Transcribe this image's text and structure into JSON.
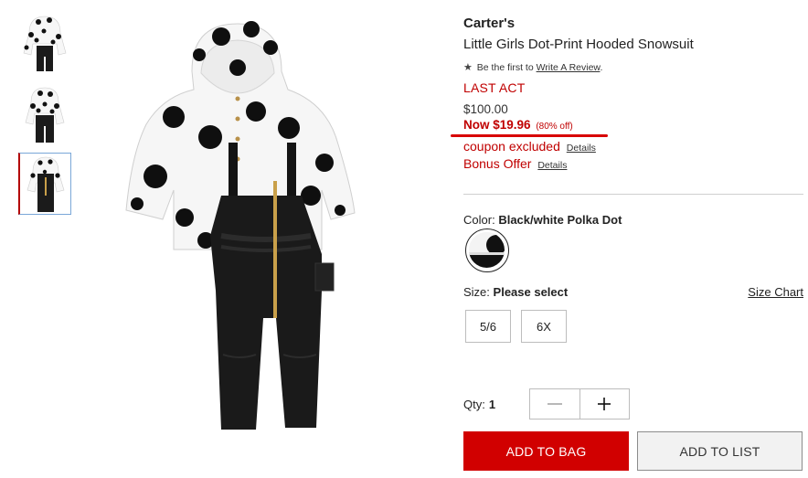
{
  "thumbnails": [
    {
      "name": "thumbnail-1",
      "selected": false
    },
    {
      "name": "thumbnail-2",
      "selected": false
    },
    {
      "name": "thumbnail-3",
      "selected": true
    }
  ],
  "product": {
    "brand": "Carter's",
    "title": "Little Girls Dot-Print Hooded Snowsuit"
  },
  "review": {
    "star_icon": "star-icon",
    "prefix": "Be the first to",
    "link": "Write A Review",
    "suffix": "."
  },
  "pricing": {
    "badge": "LAST ACT",
    "original": "$100.00",
    "now": "Now $19.96",
    "discount": "(80% off)",
    "coupon_text": "coupon excluded",
    "coupon_details": "Details",
    "bonus_text": "Bonus Offer",
    "bonus_details": "Details"
  },
  "color": {
    "label": "Color:",
    "value": "Black/white Polka Dot"
  },
  "size": {
    "label": "Size:",
    "value": "Please select",
    "chart_link": "Size Chart",
    "options": [
      "5/6",
      "6X"
    ]
  },
  "quantity": {
    "label": "Qty:",
    "value": "1",
    "decrement_icon": "minus-icon",
    "increment_icon": "plus-icon"
  },
  "actions": {
    "add_to_bag": "ADD TO BAG",
    "add_to_list": "ADD TO LIST"
  },
  "colors": {
    "accent_red": "#d10000",
    "text_red": "#c00000",
    "selected_thumb_border": "#7aa7d8"
  }
}
